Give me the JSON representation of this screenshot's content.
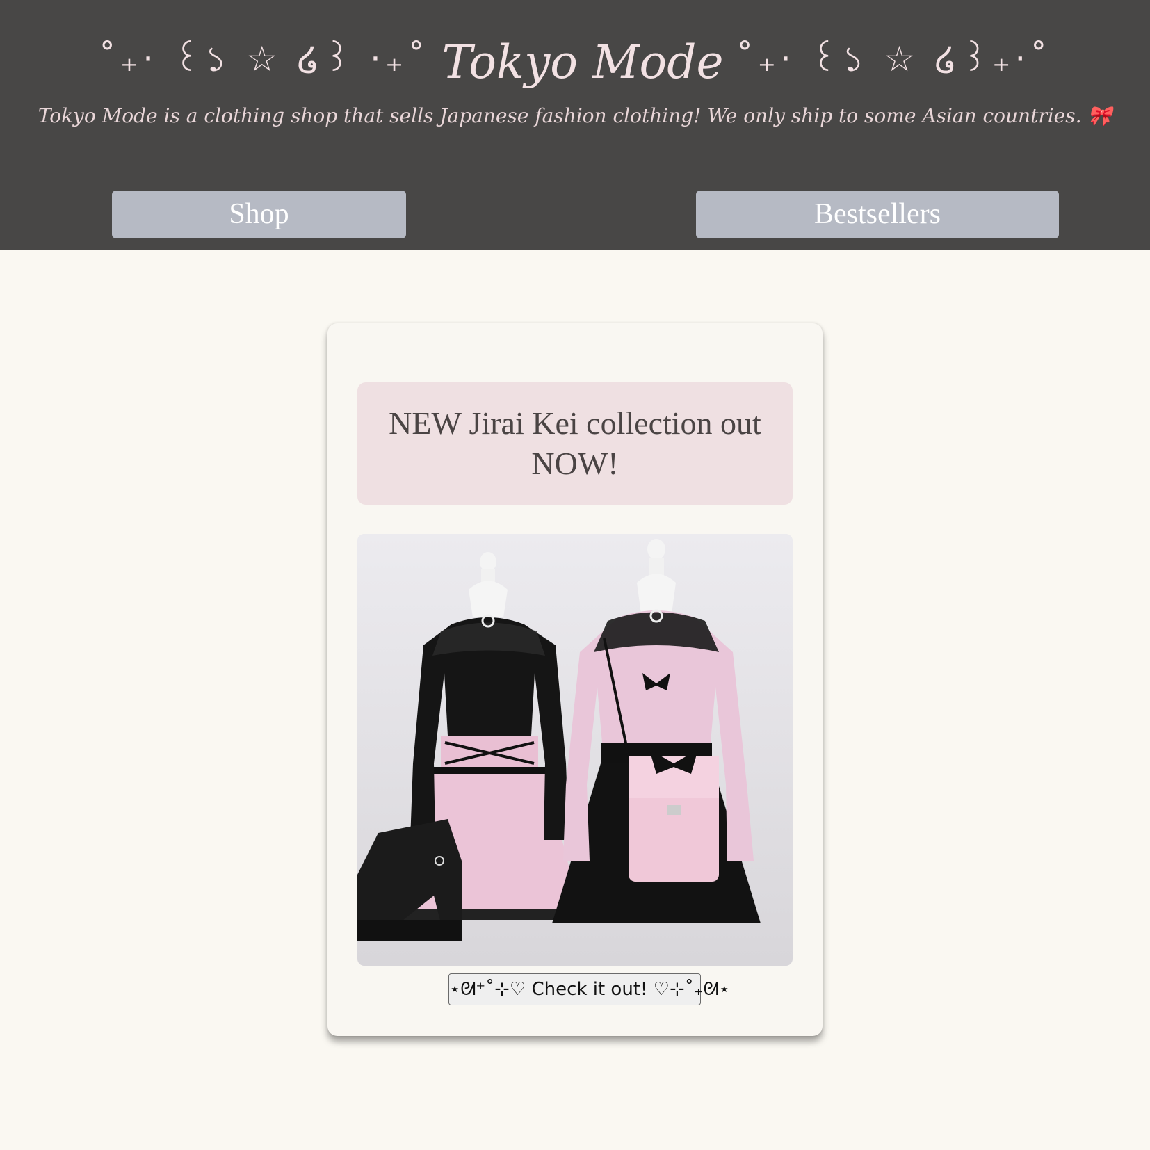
{
  "header": {
    "title_left_deco": "˚₊· ꒰১ ☆ ໒꒱ ·₊˚",
    "title": "Tokyo Mode",
    "title_right_deco": "˚₊· ꒰১ ☆ ໒꒱₊·˚",
    "tagline": "Tokyo Mode is a clothing shop that sells Japanese fashion clothing! We only ship to some Asian countries. 🎀"
  },
  "nav": {
    "shop_label": "Shop",
    "bestsellers_label": "Bestsellers"
  },
  "promo": {
    "banner": "NEW Jirai Kei collection out NOW!",
    "cta_label": "⋆ᘛ⁺˚⊹♡ Check it out! ♡⊹˚₊ᘛ⋆"
  },
  "colors": {
    "header_bg": "#484746",
    "page_bg": "#faf8f2",
    "nav_button": "#b6bac4",
    "banner_bg": "#efe0e2",
    "title_pink": "#f2e1e3"
  }
}
